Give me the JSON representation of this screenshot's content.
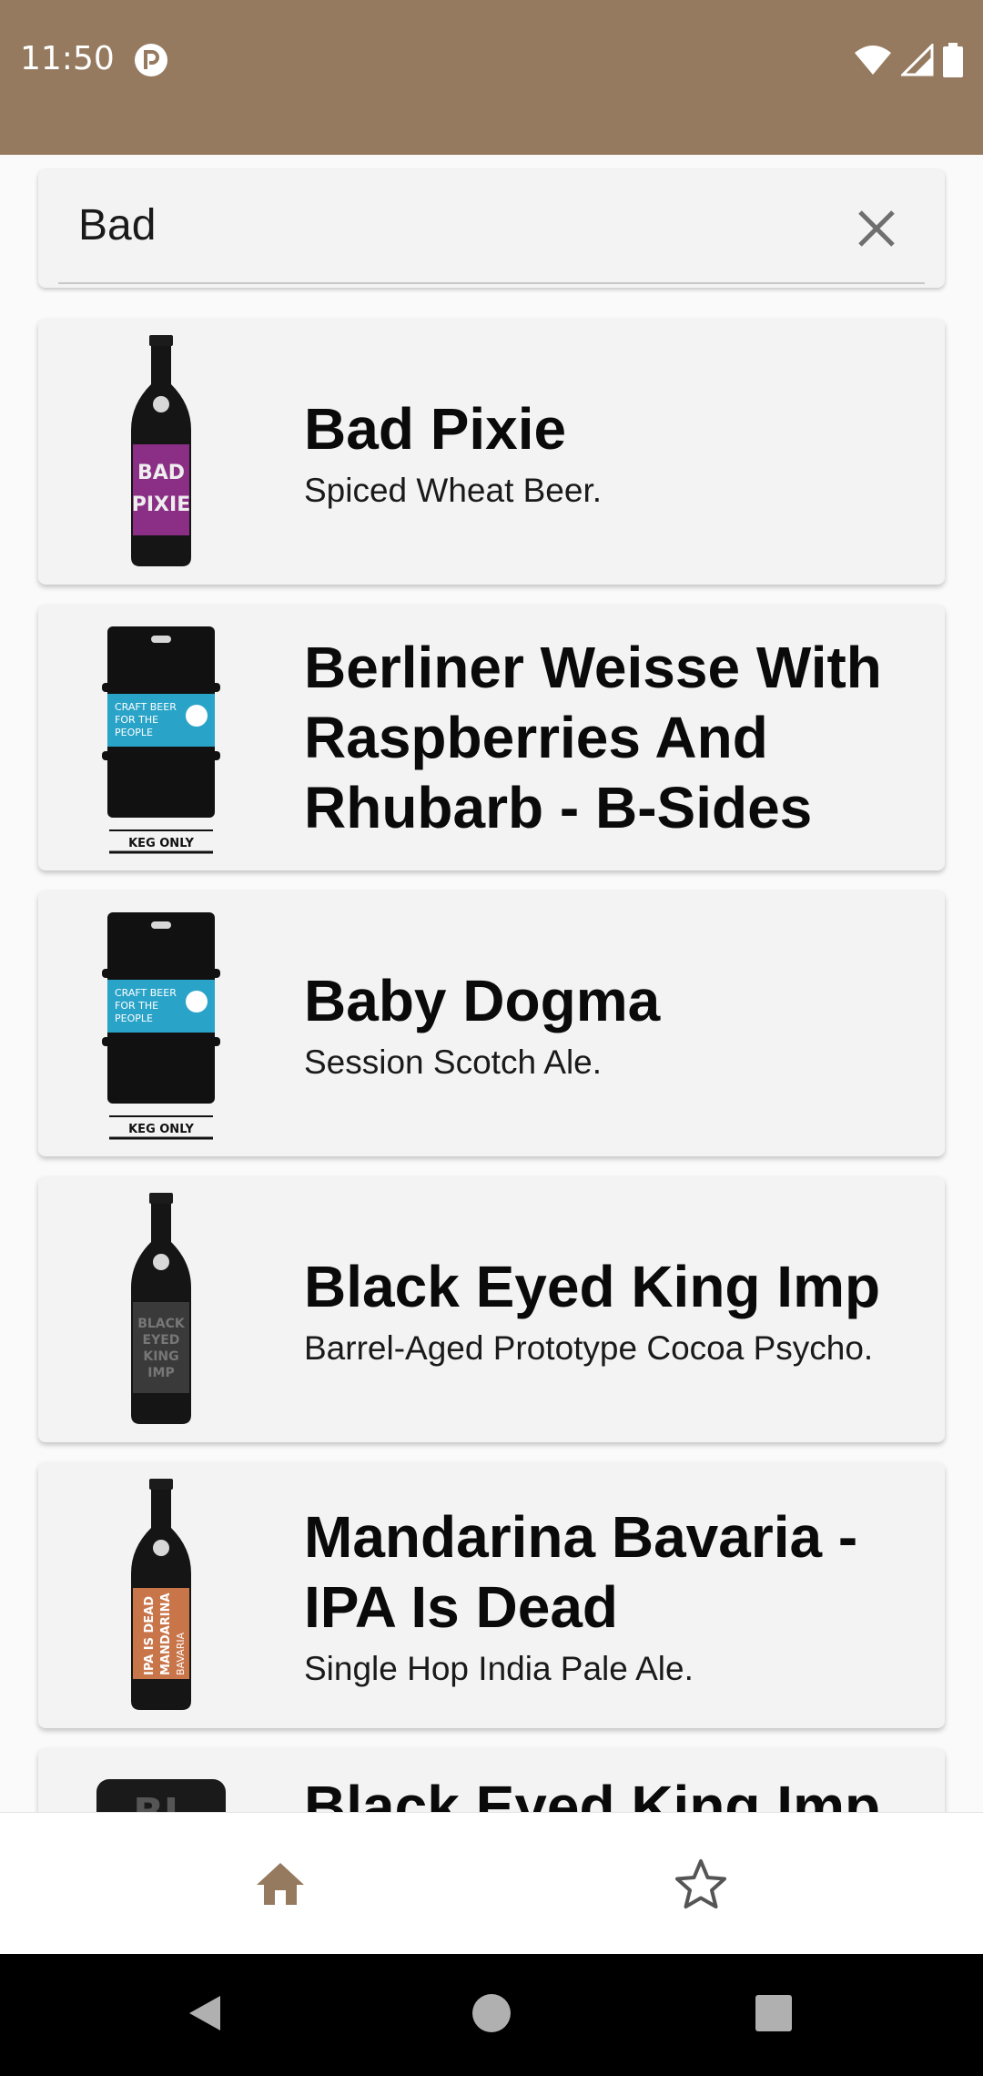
{
  "status_bar": {
    "time": "11:50",
    "background": "#957a5f"
  },
  "search": {
    "value": "Bad",
    "clear_icon": "close-icon"
  },
  "beers": [
    {
      "name": "Bad Pixie",
      "tagline": "Spiced Wheat Beer.",
      "image": "bottle",
      "label_color": "#8b2f86"
    },
    {
      "name": "Berliner Weisse With Raspberries And Rhubarb - B-Sides",
      "tagline": "",
      "image": "keg",
      "label_color": "#2aa3c8"
    },
    {
      "name": "Baby Dogma",
      "tagline": "Session Scotch Ale.",
      "image": "keg",
      "label_color": "#2aa3c8"
    },
    {
      "name": "Black Eyed King Imp",
      "tagline": "Barrel-Aged Prototype Cocoa Psycho.",
      "image": "bottle",
      "label_color": "#3a3a3a"
    },
    {
      "name": "Mandarina Bavaria - IPA Is Dead",
      "tagline": "Single Hop India Pale Ale.",
      "image": "bottle",
      "label_color": "#c9754a"
    },
    {
      "name": "Black Eyed King Imp",
      "tagline": "",
      "image": "can",
      "label_color": "#1a1a1a"
    }
  ],
  "bottom_nav": {
    "items": [
      {
        "icon": "home-icon",
        "active": true
      },
      {
        "icon": "star-icon",
        "active": false
      }
    ],
    "active_color": "#957a5f"
  },
  "system_nav": [
    "back-icon",
    "home-circle-icon",
    "recents-icon"
  ]
}
